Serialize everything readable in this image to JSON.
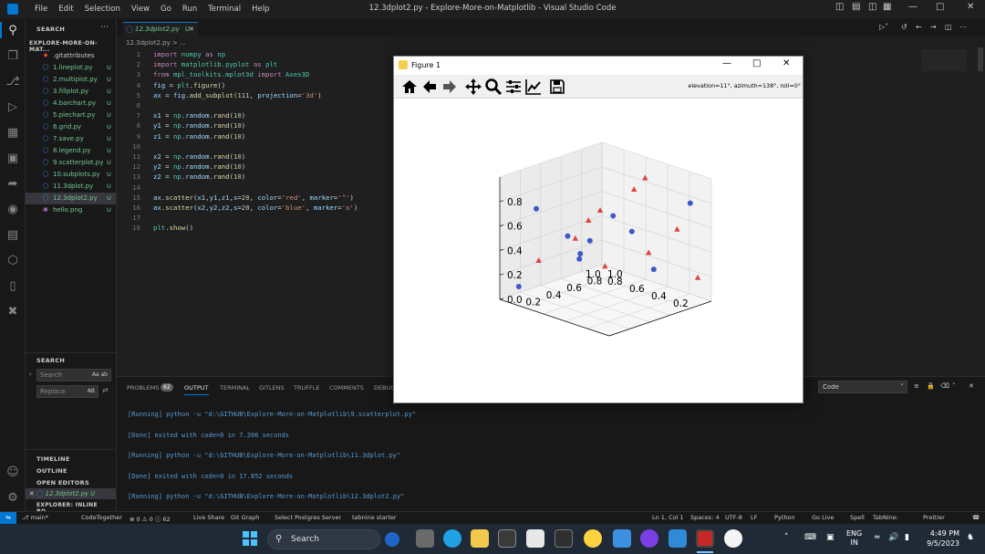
{
  "window": {
    "title": "12.3dplot2.py - Explore-More-on-Matplotlib - Visual Studio Code",
    "menu": [
      "File",
      "Edit",
      "Selection",
      "View",
      "Go",
      "Run",
      "Terminal",
      "Help"
    ]
  },
  "sidebar": {
    "header": "SEARCH",
    "root_folder": "EXPLORE-MORE-ON-MAT...",
    "files": [
      {
        "name": ".gitattributes",
        "status": ""
      },
      {
        "name": "1.lineplot.py",
        "status": "U"
      },
      {
        "name": "2.multiplot.py",
        "status": "U"
      },
      {
        "name": "3.fillplot.py",
        "status": "U"
      },
      {
        "name": "4.barchart.py",
        "status": "U"
      },
      {
        "name": "5.piechart.py",
        "status": "U"
      },
      {
        "name": "6.grid.py",
        "status": "U"
      },
      {
        "name": "7.save.py",
        "status": "U"
      },
      {
        "name": "8.legend.py",
        "status": "U"
      },
      {
        "name": "9.scatterplot.py",
        "status": "U"
      },
      {
        "name": "10.subplots.py",
        "status": "U"
      },
      {
        "name": "11.3dplot.py",
        "status": "U"
      },
      {
        "name": "12.3dplot2.py",
        "status": "U"
      },
      {
        "name": "hello.png",
        "status": "U"
      }
    ],
    "search_section": "SEARCH",
    "search_placeholder": "Search",
    "replace_placeholder": "Replace",
    "search_opts": "Aa ab",
    "replace_opts": "AB",
    "timeline": "TIMELINE",
    "outline": "OUTLINE",
    "open_editors": "OPEN EDITORS",
    "open_editor_file": "12.3dplot2.py U",
    "explorer_inline": "EXPLORER: INLINE BO..."
  },
  "editor": {
    "tab_label": "12.3dplot2.py",
    "tab_status": "U",
    "breadcrumb": "12.3dplot2.py > ...",
    "line_numbers": [
      "1",
      "2",
      "3",
      "4",
      "5",
      "6",
      "7",
      "8",
      "9",
      "10",
      "11",
      "12",
      "13",
      "14",
      "15",
      "16",
      "17",
      "18"
    ],
    "code": [
      "import numpy as np",
      "import matplotlib.pyplot as plt",
      "from mpl_toolkits.mplot3d import Axes3D",
      "fig = plt.figure()",
      "ax = fig.add_subplot(111, projection='3d')",
      "",
      "x1 = np.random.rand(10)",
      "y1 = np.random.rand(10)",
      "z1 = np.random.rand(10)",
      "",
      "x2 = np.random.rand(10)",
      "y2 = np.random.rand(10)",
      "z2 = np.random.rand(10)",
      "",
      "ax.scatter(x1,y1,z1,s=20, color='red', marker='^')",
      "ax.scatter(x2,y2,z2,s=20, color='blue', marker='o')",
      "",
      "plt.show()"
    ]
  },
  "panel": {
    "tabs": [
      "PROBLEMS",
      "OUTPUT",
      "TERMINAL",
      "GITLENS",
      "TRUFFLE",
      "COMMENTS",
      "DEBUG"
    ],
    "problems_count": "62",
    "dropdown_value": "Code",
    "output_lines": [
      "[Running] python -u \"d:\\GITHUB\\Explore-More-on-Matplotlib\\9.scatterplot.py\"",
      "[Done] exited with code=0 in 7.206 seconds",
      "[Running] python -u \"d:\\GITHUB\\Explore-More-on-Matplotlib\\11.3dplot.py\"",
      "[Done] exited with code=0 in 17.852 seconds",
      "[Running] python -u \"d:\\GITHUB\\Explore-More-on-Matplotlib\\12.3dplot2.py\""
    ]
  },
  "statusbar": {
    "branch": "main*",
    "codetogether": "CodeTogether",
    "problems": "⊗ 0 ⚠ 0 ⓘ 62",
    "liveshare": "Live Share",
    "gitgraph": "Git Graph",
    "postgres": "Select Postgres Server",
    "tabnine": "tabnine starter",
    "cursor": "Ln 1, Col 1",
    "spaces": "Spaces: 4",
    "encoding": "UTF-8",
    "eol": "LF",
    "language": "Python",
    "golive": "Go Live",
    "spell": "Spell",
    "tabnine_status": "TabNine:",
    "prettier": "Prettier"
  },
  "figure": {
    "title": "Figure 1",
    "coords": "elevation=11°, azimuth=138°, roll=0°",
    "toolbar_icons": [
      "home-icon",
      "back-icon",
      "forward-icon",
      "pan-icon",
      "zoom-icon",
      "configure-subplots-icon",
      "edit-axis-icon",
      "save-icon"
    ]
  },
  "chart_data": {
    "type": "scatter",
    "projection": "3d",
    "view": {
      "elevation": 11,
      "azimuth": 138,
      "roll": 0
    },
    "series": [
      {
        "name": "",
        "color": "#d62728",
        "marker": "^",
        "points": [
          [
            0.62,
            0.35,
            0.9
          ],
          [
            0.8,
            0.4,
            0.45
          ],
          [
            0.55,
            0.85,
            0.62
          ],
          [
            0.45,
            0.5,
            0.72
          ],
          [
            0.78,
            0.1,
            0.55
          ],
          [
            0.95,
            0.08,
            0.2
          ],
          [
            0.25,
            0.4,
            0.55
          ],
          [
            0.7,
            0.72,
            0.4
          ],
          [
            0.6,
            0.22,
            0.95
          ],
          [
            0.15,
            0.78,
            0.3
          ]
        ]
      },
      {
        "name": "",
        "color": "#1f3fbf",
        "marker": "o",
        "points": [
          [
            0.9,
            0.1,
            0.8
          ],
          [
            0.45,
            0.6,
            0.5
          ],
          [
            0.55,
            0.48,
            0.7
          ],
          [
            0.6,
            0.35,
            0.55
          ],
          [
            0.4,
            0.65,
            0.35
          ],
          [
            0.2,
            0.55,
            0.45
          ],
          [
            0.25,
            0.48,
            0.3
          ],
          [
            0.1,
            0.75,
            0.7
          ],
          [
            0.8,
            0.35,
            0.3
          ],
          [
            0.08,
            0.9,
            0.1
          ]
        ]
      }
    ],
    "x_ticks": [
      "0.2",
      "0.4",
      "0.6",
      "0.8",
      "1.0"
    ],
    "y_ticks": [
      "0.2",
      "0.4",
      "0.6",
      "0.8",
      "1.0"
    ],
    "z_ticks": [
      "0.0",
      "0.2",
      "0.4",
      "0.6",
      "0.8"
    ],
    "xlim": [
      0,
      1
    ],
    "ylim": [
      0,
      1
    ],
    "zlim": [
      0,
      1
    ],
    "grid": true
  },
  "taskbar": {
    "search_label": "Search",
    "lang_line1": "ENG",
    "lang_line2": "IN",
    "time": "4:49 PM",
    "date": "9/5/2023"
  }
}
